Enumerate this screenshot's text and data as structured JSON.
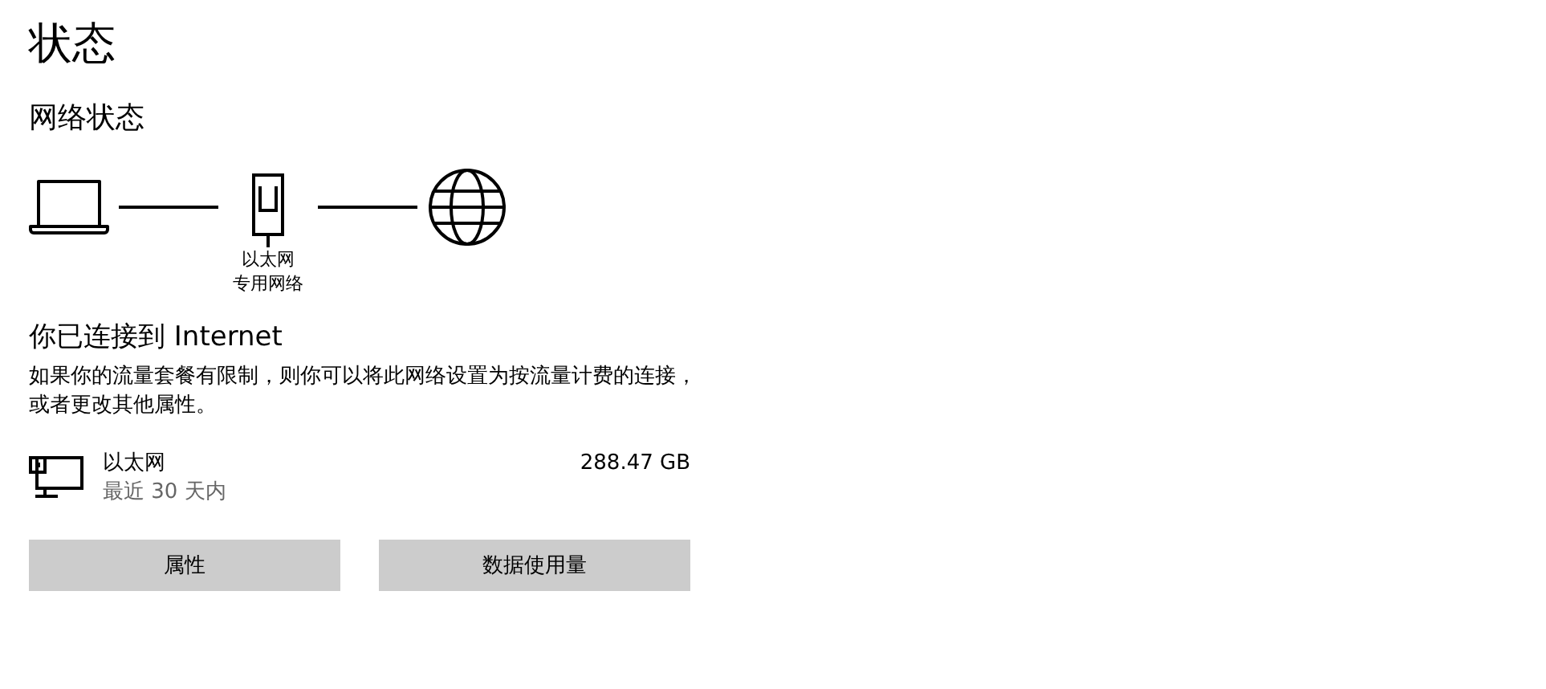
{
  "page": {
    "title": "状态",
    "section_title": "网络状态"
  },
  "diagram": {
    "adapter_label": "以太网",
    "network_label": "专用网络"
  },
  "connection": {
    "heading": "你已连接到 Internet",
    "description": "如果你的流量套餐有限制，则你可以将此网络设置为按流量计费的连接，或者更改其他属性。"
  },
  "adapter": {
    "name": "以太网",
    "period": "最近 30 天内",
    "usage": "288.47 GB"
  },
  "buttons": [
    "属性",
    "数据使用量"
  ]
}
